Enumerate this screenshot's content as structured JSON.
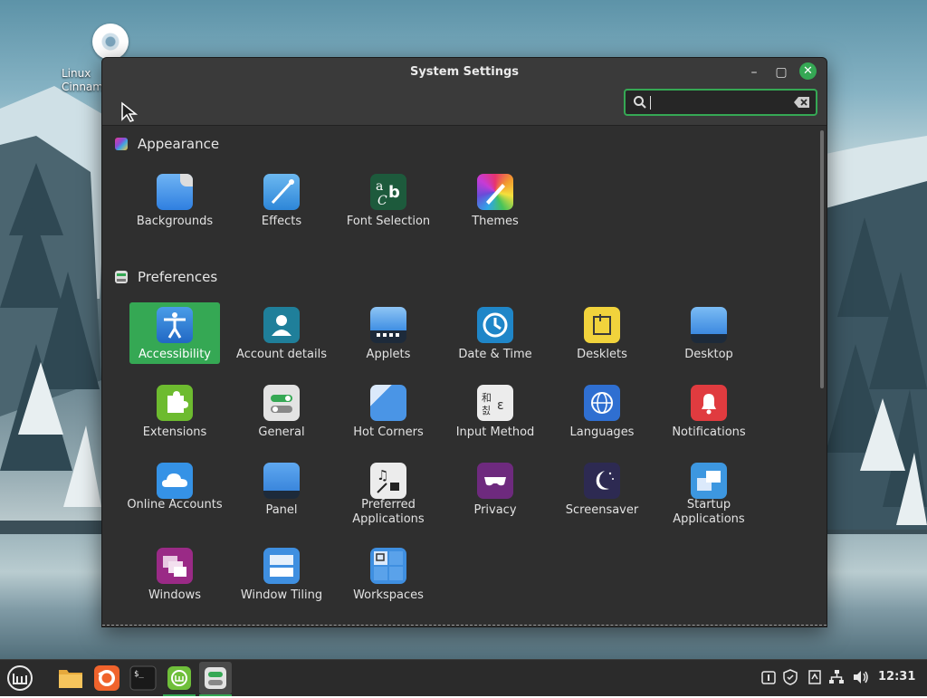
{
  "window": {
    "title": "System Settings",
    "minimize_label": "–",
    "maximize_label": "▢",
    "close_label": "✕"
  },
  "search": {
    "value": "",
    "placeholder": ""
  },
  "desktop": {
    "icon_label_line1": "Linux",
    "icon_label_line2": "Cinnam"
  },
  "sections": [
    {
      "title": "Appearance",
      "items": [
        {
          "label": "Backgrounds",
          "icon": "backgrounds-icon"
        },
        {
          "label": "Effects",
          "icon": "effects-icon"
        },
        {
          "label": "Font Selection",
          "icon": "font-selection-icon"
        },
        {
          "label": "Themes",
          "icon": "themes-icon"
        }
      ]
    },
    {
      "title": "Preferences",
      "items": [
        {
          "label": "Accessibility",
          "icon": "accessibility-icon",
          "selected": true
        },
        {
          "label": "Account details",
          "icon": "account-details-icon"
        },
        {
          "label": "Applets",
          "icon": "applets-icon"
        },
        {
          "label": "Date & Time",
          "icon": "date-time-icon"
        },
        {
          "label": "Desklets",
          "icon": "desklets-icon"
        },
        {
          "label": "Desktop",
          "icon": "desktop-icon"
        },
        {
          "label": "Extensions",
          "icon": "extensions-icon"
        },
        {
          "label": "General",
          "icon": "general-icon"
        },
        {
          "label": "Hot Corners",
          "icon": "hot-corners-icon"
        },
        {
          "label": "Input Method",
          "icon": "input-method-icon"
        },
        {
          "label": "Languages",
          "icon": "languages-icon"
        },
        {
          "label": "Notifications",
          "icon": "notifications-icon"
        },
        {
          "label": "Online Accounts",
          "icon": "online-accounts-icon"
        },
        {
          "label": "Panel",
          "icon": "panel-icon"
        },
        {
          "label": "Preferred Applications",
          "icon": "preferred-applications-icon"
        },
        {
          "label": "Privacy",
          "icon": "privacy-icon"
        },
        {
          "label": "Screensaver",
          "icon": "screensaver-icon"
        },
        {
          "label": "Startup Applications",
          "icon": "startup-applications-icon"
        },
        {
          "label": "Windows",
          "icon": "windows-icon"
        },
        {
          "label": "Window Tiling",
          "icon": "window-tiling-icon"
        },
        {
          "label": "Workspaces",
          "icon": "workspaces-icon"
        }
      ]
    }
  ],
  "taskbar": {
    "apps": [
      "mint-menu-icon",
      "files-icon",
      "firefox-icon",
      "terminal-icon",
      "mintinstall-icon",
      "system-settings-icon"
    ],
    "tray": [
      "updates-icon",
      "shield-icon",
      "notes-icon",
      "network-icon",
      "volume-icon"
    ],
    "clock": "12:31"
  },
  "colors": {
    "accent": "#35a854",
    "window_bg": "#2f2f2f",
    "panel_bg": "#2b2b2b"
  }
}
